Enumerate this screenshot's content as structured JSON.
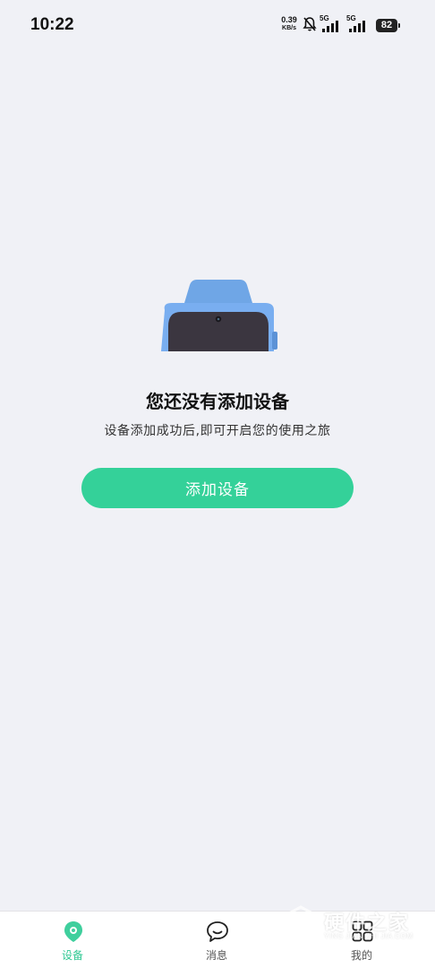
{
  "status_bar": {
    "time": "10:22",
    "net_speed_value": "0.39",
    "net_speed_unit": "KB/s",
    "sim1_label": "5G",
    "sim2_label": "5G",
    "battery": "82"
  },
  "empty_state": {
    "title": "您还没有添加设备",
    "subtitle": "设备添加成功后,即可开启您的使用之旅",
    "add_button_label": "添加设备"
  },
  "bottom_nav": {
    "items": [
      {
        "label": "设备",
        "icon": "device-location-icon",
        "active": true
      },
      {
        "label": "消息",
        "icon": "chat-bubble-icon",
        "active": false
      },
      {
        "label": "我的",
        "icon": "grid-apps-icon",
        "active": false
      }
    ]
  },
  "watermark": {
    "text": "硬件之家",
    "sub": "YING JIAN ZHI JIA.COM"
  },
  "colors": {
    "accent": "#34d199",
    "background": "#f0f1f6",
    "watch_band": "#6fa6e6",
    "watch_screen": "#3b3640"
  }
}
